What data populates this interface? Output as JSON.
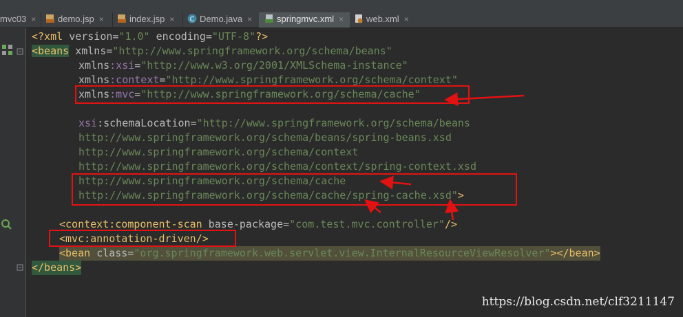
{
  "tabs": [
    {
      "label": "mvc03",
      "icon": "none",
      "active": false
    },
    {
      "label": "demo.jsp",
      "icon": "jsp-file-icon",
      "active": false
    },
    {
      "label": "index.jsp",
      "icon": "jsp-file-icon",
      "active": false
    },
    {
      "label": "Demo.java",
      "icon": "java-class-icon",
      "active": false
    },
    {
      "label": "springmvc.xml",
      "icon": "xml-file-icon",
      "active": true
    },
    {
      "label": "web.xml",
      "icon": "web-xml-icon",
      "active": false
    }
  ],
  "tab_close_glyph": "×",
  "code": {
    "l1": {
      "a": "<?xml ",
      "b": "version",
      "c": "=",
      "d": "\"1.0\"",
      "e": " ",
      "f": "encoding",
      "g": "=",
      "h": "\"UTF-8\"",
      "i": "?>"
    },
    "l2": {
      "a": "<beans",
      "b": " xmlns",
      "c": "=",
      "d": "\"http://www.springframework.org/schema/beans\""
    },
    "l3": {
      "a": "xmlns",
      "b": ":xsi",
      "c": "=",
      "d": "\"http://www.w3.org/2001/XMLSchema-instance\""
    },
    "l4": {
      "a": "xmlns",
      "b": ":context",
      "c": "=",
      "d": "\"http://www.springframework.org/schema/context\""
    },
    "l5": {
      "a": "xmlns",
      "b": ":mvc",
      "c": "=",
      "d": "\"http://www.springframework.org/schema/cache\""
    },
    "l6": {
      "a": "xsi",
      "b": ":schemaLocation",
      "c": "=",
      "d": "\"http://www.springframework.org/schema/beans"
    },
    "l7": "http://www.springframework.org/schema/beans/spring-beans.xsd",
    "l8": "http://www.springframework.org/schema/context",
    "l9": "http://www.springframework.org/schema/context/spring-context.xsd",
    "l10": "http://www.springframework.org/schema/cache",
    "l11": {
      "a": "http://www.springframework.org/schema/cache/spring-cache.xsd\"",
      "b": ">"
    },
    "l12": {
      "a": "<context",
      "b": ":component-scan ",
      "c": "base-package",
      "d": "=",
      "e": "\"com.test.mvc.controller\"",
      "f": "/>"
    },
    "l13": {
      "a": "<mvc",
      "b": ":annotation-driven",
      "c": "/>"
    },
    "l14": {
      "a": "<bean ",
      "b": "class",
      "c": "=",
      "d": "\"org.springframework.web.servlet.view.InternalResourceViewResolver\"",
      "e": "></bean>"
    },
    "l15": "</beans>"
  },
  "watermark": "https://blog.csdn.net/clf3211147",
  "colors": {
    "annotation_red": "#e31212",
    "tag": "#e8bf6a",
    "string": "#6a8759",
    "namespace": "#9876aa"
  }
}
